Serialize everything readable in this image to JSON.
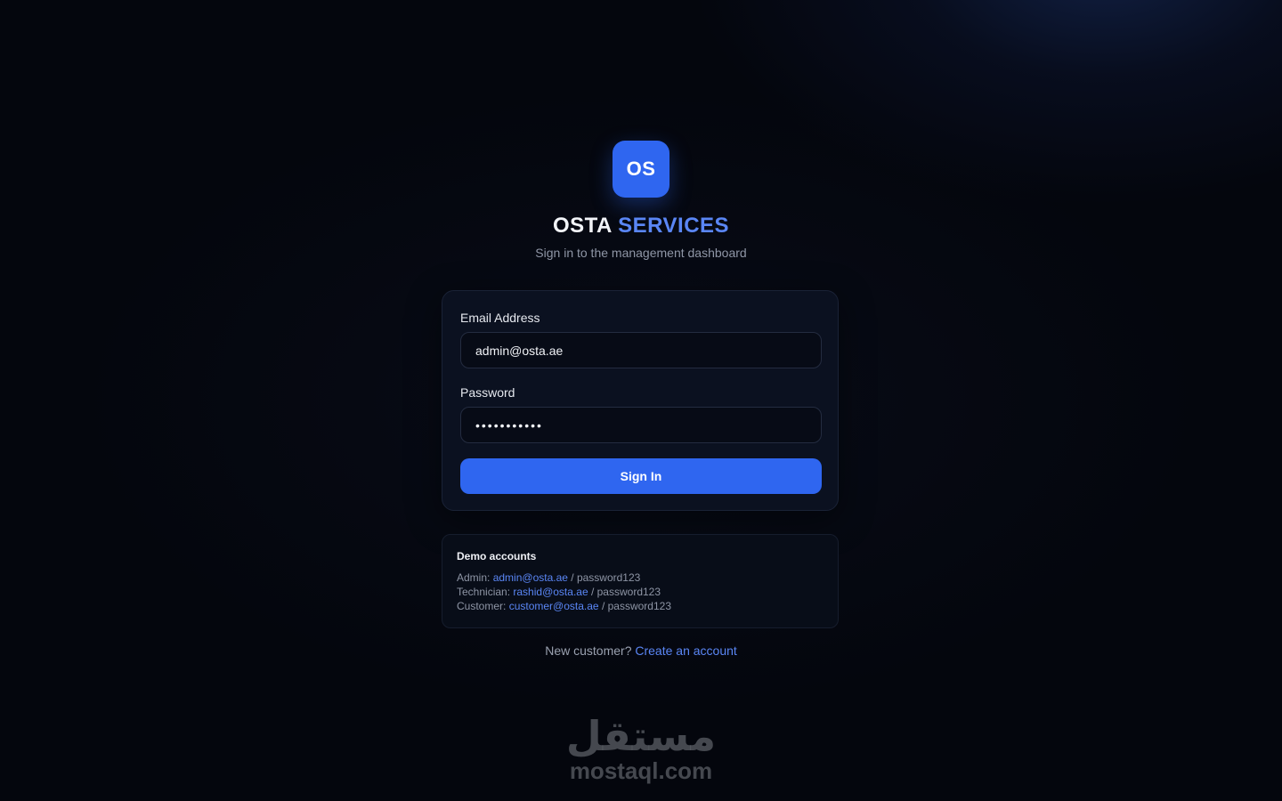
{
  "brand": {
    "logo_text": "OS",
    "name_primary": "OSTA",
    "name_accent": "SERVICES",
    "subtitle": "Sign in to the management dashboard"
  },
  "form": {
    "email_label": "Email Address",
    "email_value": "admin@osta.ae",
    "password_label": "Password",
    "password_value": "•••••••••••",
    "submit_label": "Sign In"
  },
  "demo": {
    "title": "Demo accounts",
    "accounts": [
      {
        "role": "Admin:",
        "email": "admin@osta.ae",
        "password": "/ password123"
      },
      {
        "role": "Technician:",
        "email": "rashid@osta.ae",
        "password": "/ password123"
      },
      {
        "role": "Customer:",
        "email": "customer@osta.ae",
        "password": "/ password123"
      }
    ]
  },
  "footer": {
    "prompt": "New customer?",
    "link": "Create an account"
  },
  "watermark": {
    "arabic": "مستقل",
    "domain": "mostaql.com"
  },
  "colors": {
    "background": "#04060d",
    "accent": "#2f66f0",
    "link": "#5a86f5",
    "card": "#0b1120"
  }
}
